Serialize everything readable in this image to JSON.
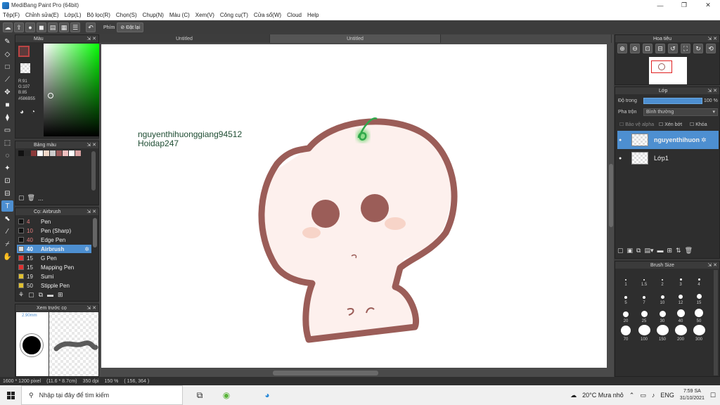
{
  "window": {
    "title": "MediBang Paint Pro (64bit)",
    "minimize": "—",
    "maximize": "❐",
    "close": "✕"
  },
  "menu": [
    "Tệp(F)",
    "Chỉnh sửa(E)",
    "Lớp(L)",
    "Bộ lọc(R)",
    "Chọn(S)",
    "Chụp(N)",
    "Màu (C)",
    "Xem(V)",
    "Công cụ(T)",
    "Cửa sổ(W)",
    "Cloud",
    "Help"
  ],
  "toolbar": {
    "phim_label": "Phím",
    "reset_label": "Đặt lại"
  },
  "color_panel": {
    "title": "Màu",
    "r": "R:91",
    "g": "G:107",
    "b": "B:85",
    "hex": "#586B55",
    "main_color": "#5b3b3b"
  },
  "palette_panel": {
    "title": "Bảng màu",
    "more": "...",
    "swatches": [
      "#111111",
      "#2a2a2a",
      "#8b3a3a",
      "#ffffff",
      "#f0d8c8",
      "#cccccc",
      "#9b5a5a",
      "#f0c0c0",
      "#ffffff",
      "#d8a0a0"
    ]
  },
  "brush_panel": {
    "title": "Cọ: Airbrush",
    "items": [
      {
        "size": "4",
        "name": "Pen",
        "color": "#111111"
      },
      {
        "size": "10",
        "name": "Pen (Sharp)",
        "color": "#111111"
      },
      {
        "size": "40",
        "name": "Edge Pen",
        "color": "#111111"
      },
      {
        "size": "40",
        "name": "Airbrush",
        "color": "#dddddd"
      },
      {
        "size": "15",
        "name": "G Pen",
        "color": "#e03030"
      },
      {
        "size": "15",
        "name": "Mapping Pen",
        "color": "#e03030"
      },
      {
        "size": "19",
        "name": "Sumi",
        "color": "#e0c030"
      },
      {
        "size": "50",
        "name": "Stipple Pen",
        "color": "#e0c030"
      }
    ]
  },
  "preview_panel": {
    "title": "Xem trước cọ",
    "size_label": "2.90mm"
  },
  "doc_tabs": [
    "Untitled",
    "Untitled"
  ],
  "canvas": {
    "watermark_line1": "nguyenthihuonggiang94512",
    "watermark_line2": "Hoidap247"
  },
  "navigator": {
    "title": "Hoa tiêu"
  },
  "layer_panel": {
    "title": "Lớp",
    "opacity_label": "Độ trong",
    "opacity_value": "100 %",
    "blend_label": "Pha trộn",
    "blend_value": "Bình thường",
    "protect_alpha": "Bảo vệ alpha",
    "clip_label": "Xén bớt",
    "lock_label": "Khóa",
    "layers": [
      {
        "name": "nguyenthihuon"
      },
      {
        "name": "Lớp1"
      }
    ]
  },
  "brush_size_panel": {
    "title": "Brush Size",
    "sizes": [
      "1",
      "1.5",
      "2",
      "3",
      "4",
      "5",
      "7",
      "10",
      "12",
      "15",
      "20",
      "25",
      "30",
      "40",
      "50",
      "70",
      "100",
      "150",
      "200",
      "300"
    ]
  },
  "status": {
    "dims": "1600 * 1200 pixel",
    "physical": "(11.6 * 8.7cm)",
    "dpi": "350 dpi",
    "zoom": "150 %",
    "coords": "( 156, 364 )"
  },
  "taskbar": {
    "search_placeholder": "Nhập tại đây để tìm kiếm",
    "weather": "20°C  Mưa nhỏ",
    "lang": "ENG",
    "time": "7:59 SA",
    "date": "31/10/2021"
  }
}
